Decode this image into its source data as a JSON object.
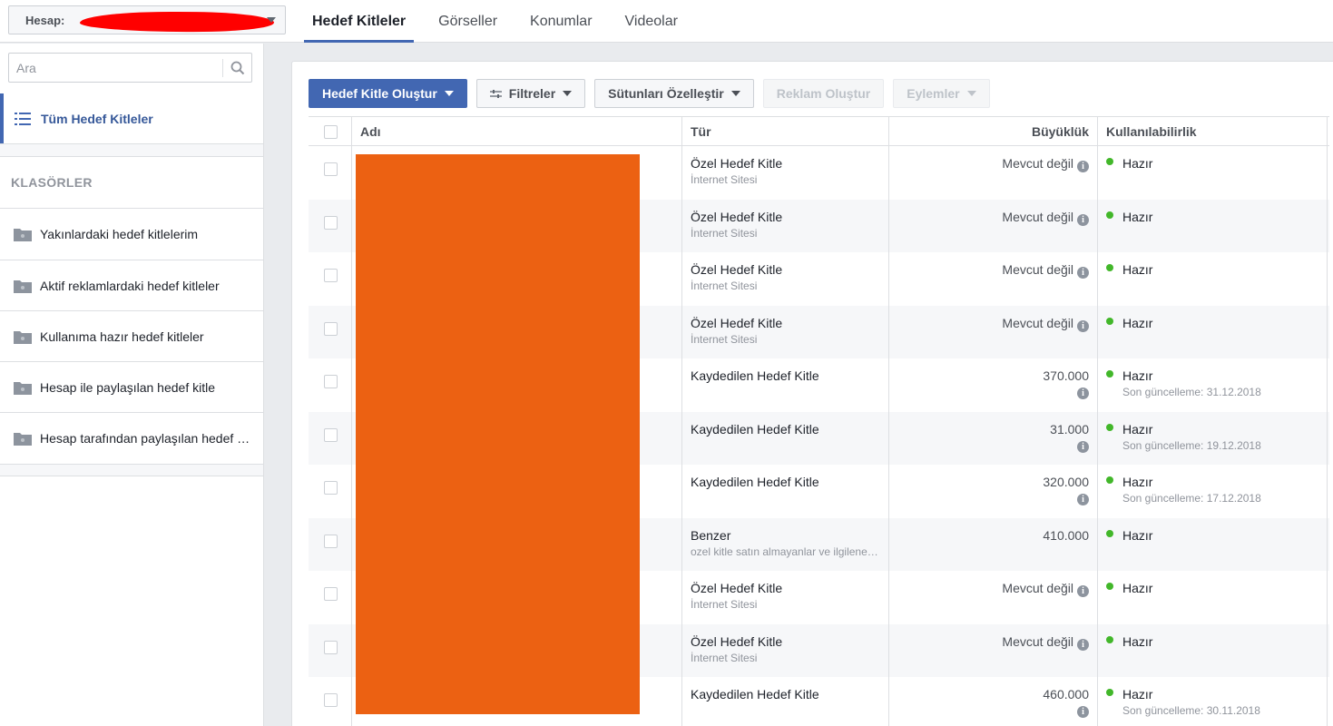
{
  "account": {
    "label": "Hesap:"
  },
  "tabs": [
    {
      "label": "Hedef Kitleler",
      "active": true
    },
    {
      "label": "Görseller",
      "active": false
    },
    {
      "label": "Konumlar",
      "active": false
    },
    {
      "label": "Videolar",
      "active": false
    }
  ],
  "sidebar": {
    "search_placeholder": "Ara",
    "all_audiences": "Tüm Hedef Kitleler",
    "folders_title": "KLASÖRLER",
    "folders": [
      "Yakınlardaki hedef kitlelerim",
      "Aktif reklamlardaki hedef kitleler",
      "Kullanıma hazır hedef kitleler",
      "Hesap ile paylaşılan hedef kitle",
      "Hesap tarafından paylaşılan hedef kitleler"
    ]
  },
  "toolbar": {
    "create_audience": "Hedef Kitle Oluştur",
    "filters": "Filtreler",
    "customize_columns": "Sütunları Özelleştir",
    "create_ad": "Reklam Oluştur",
    "actions": "Eylemler"
  },
  "table": {
    "headers": {
      "name": "Adı",
      "type": "Tür",
      "size": "Büyüklük",
      "availability": "Kullanılabilirlik"
    },
    "rows": [
      {
        "type": "Özel Hedef Kitle",
        "subtype": "İnternet Sitesi",
        "size": "Mevcut değil",
        "status": "Hazır",
        "updated": ""
      },
      {
        "type": "Özel Hedef Kitle",
        "subtype": "İnternet Sitesi",
        "size": "Mevcut değil",
        "status": "Hazır",
        "updated": ""
      },
      {
        "type": "Özel Hedef Kitle",
        "subtype": "İnternet Sitesi",
        "size": "Mevcut değil",
        "status": "Hazır",
        "updated": ""
      },
      {
        "type": "Özel Hedef Kitle",
        "subtype": "İnternet Sitesi",
        "size": "Mevcut değil",
        "status": "Hazır",
        "updated": ""
      },
      {
        "type": "Kaydedilen Hedef Kitle",
        "subtype": "",
        "size": "370.000",
        "status": "Hazır",
        "updated": "Son güncelleme: 31.12.2018"
      },
      {
        "type": "Kaydedilen Hedef Kitle",
        "subtype": "",
        "size": "31.000",
        "status": "Hazır",
        "updated": "Son güncelleme: 19.12.2018"
      },
      {
        "type": "Kaydedilen Hedef Kitle",
        "subtype": "",
        "size": "320.000",
        "status": "Hazır",
        "updated": "Son güncelleme: 17.12.2018"
      },
      {
        "type": "Benzer",
        "subtype": "ozel kitle satın almayanlar ve ilgilenenler",
        "size": "410.000",
        "status": "Hazır",
        "updated": ""
      },
      {
        "type": "Özel Hedef Kitle",
        "subtype": "İnternet Sitesi",
        "size": "Mevcut değil",
        "status": "Hazır",
        "updated": ""
      },
      {
        "type": "Özel Hedef Kitle",
        "subtype": "İnternet Sitesi",
        "size": "Mevcut değil",
        "status": "Hazır",
        "updated": ""
      },
      {
        "type": "Kaydedilen Hedef Kitle",
        "subtype": "",
        "size": "460.000",
        "status": "Hazır",
        "updated": "Son güncelleme: 30.11.2018"
      }
    ]
  },
  "colors": {
    "accent": "#4267b2",
    "ready": "#42b72a",
    "redaction_orange": "#ec6112",
    "redaction_red": "#ff0000"
  }
}
